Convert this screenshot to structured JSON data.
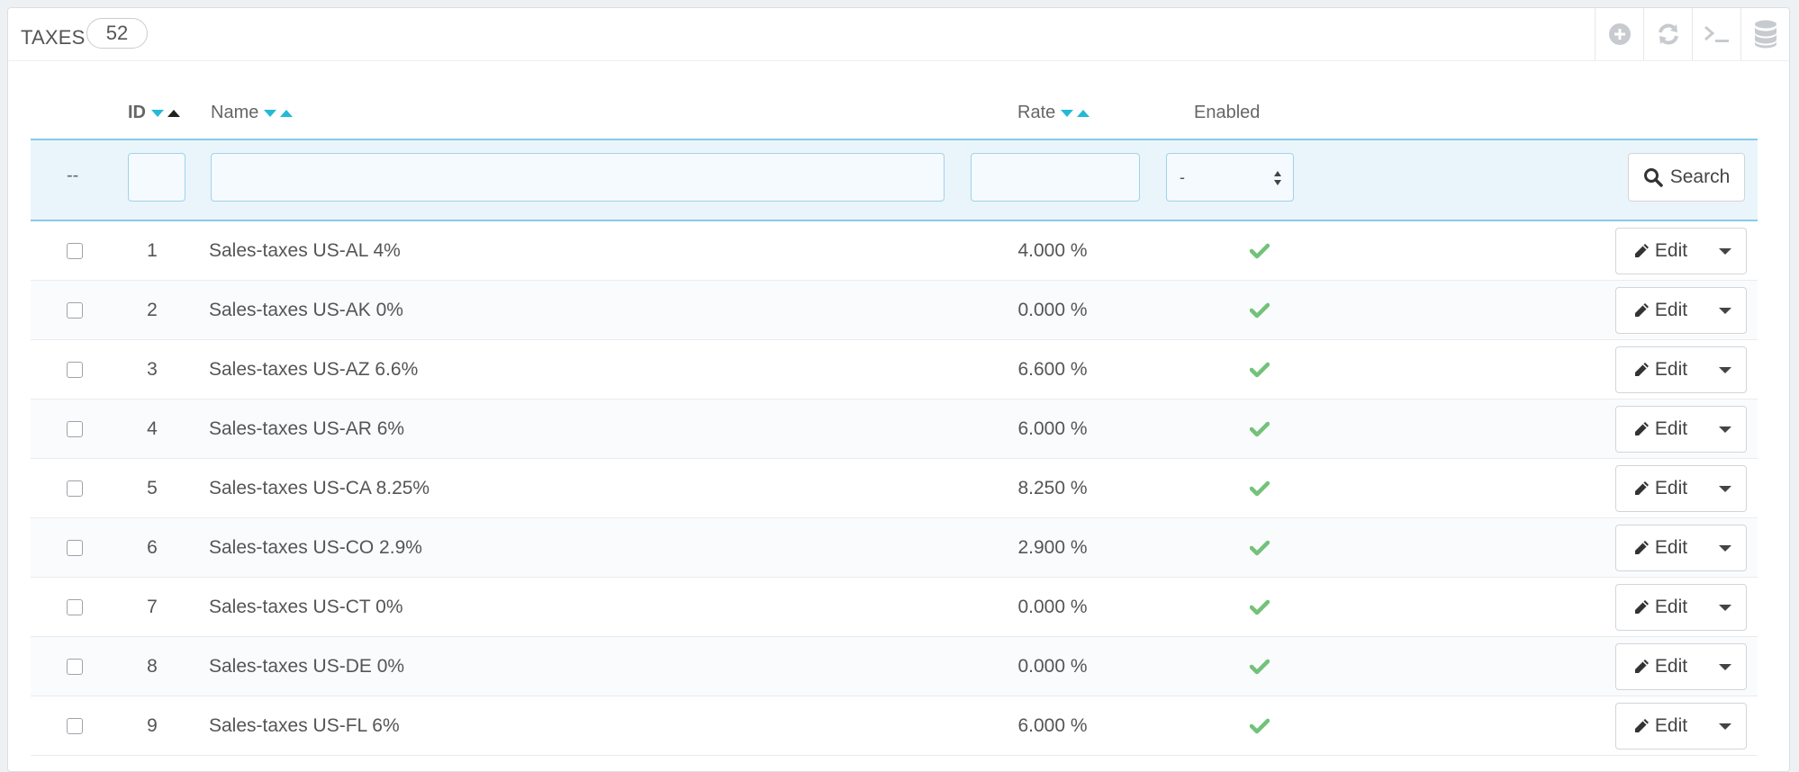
{
  "panel": {
    "title": "TAXES",
    "count": "52"
  },
  "toolbar": {
    "icons": [
      "add-icon",
      "refresh-icon",
      "sql-terminal-icon",
      "database-icon"
    ]
  },
  "columns": {
    "id": "ID",
    "name": "Name",
    "rate": "Rate",
    "enabled": "Enabled"
  },
  "filters": {
    "bulk": "--",
    "enabled_value": "-",
    "search_label": "Search"
  },
  "row_action": "Edit",
  "colors": {
    "accent": "#25b9d7",
    "check": "#72c279",
    "filter_bg": "#eaf5fb"
  },
  "rows": [
    {
      "id": "1",
      "name": "Sales-taxes US-AL 4%",
      "rate": "4.000 %"
    },
    {
      "id": "2",
      "name": "Sales-taxes US-AK 0%",
      "rate": "0.000 %"
    },
    {
      "id": "3",
      "name": "Sales-taxes US-AZ 6.6%",
      "rate": "6.600 %"
    },
    {
      "id": "4",
      "name": "Sales-taxes US-AR 6%",
      "rate": "6.000 %"
    },
    {
      "id": "5",
      "name": "Sales-taxes US-CA 8.25%",
      "rate": "8.250 %"
    },
    {
      "id": "6",
      "name": "Sales-taxes US-CO 2.9%",
      "rate": "2.900 %"
    },
    {
      "id": "7",
      "name": "Sales-taxes US-CT 0%",
      "rate": "0.000 %"
    },
    {
      "id": "8",
      "name": "Sales-taxes US-DE 0%",
      "rate": "0.000 %"
    },
    {
      "id": "9",
      "name": "Sales-taxes US-FL 6%",
      "rate": "6.000 %"
    }
  ]
}
